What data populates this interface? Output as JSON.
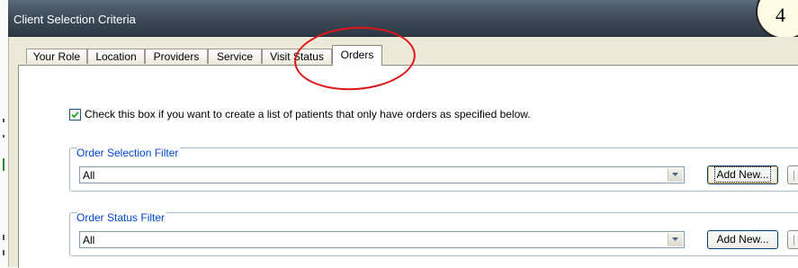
{
  "window": {
    "title": "Client Selection Criteria"
  },
  "step_badge": "4",
  "tabs": [
    {
      "label": "Your Role",
      "active": false
    },
    {
      "label": "Location",
      "active": false
    },
    {
      "label": "Providers",
      "active": false
    },
    {
      "label": "Service",
      "active": false
    },
    {
      "label": "Visit Status",
      "active": false
    },
    {
      "label": "Orders",
      "active": true
    }
  ],
  "orders_panel": {
    "only_orders_checkbox": {
      "checked": true,
      "label": "Check this box if you want to create a list of patients that only have orders as specified below."
    },
    "order_selection_filter": {
      "title": "Order Selection Filter",
      "selected": "All",
      "add_button": "Add New..."
    },
    "order_status_filter": {
      "title": "Order Status Filter",
      "selected": "All",
      "add_button": "Add New..."
    }
  },
  "colors": {
    "annotation_ring": "#e01515",
    "group_title": "#0046d5",
    "titlebar": "#3f4d5c"
  },
  "icons": [
    "checkmark-icon",
    "dropdown-arrow-icon"
  ]
}
